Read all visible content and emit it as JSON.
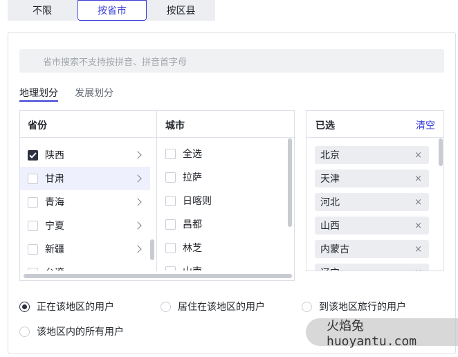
{
  "top_tabs": [
    {
      "label": "不限"
    },
    {
      "label": "按省市"
    },
    {
      "label": "按区县"
    }
  ],
  "search": {
    "placeholder": "省市搜索不支持按拼音、拼音首字母"
  },
  "division_tabs": [
    {
      "label": "地理划分"
    },
    {
      "label": "发展划分"
    }
  ],
  "province_panel": {
    "header": "省份",
    "items": [
      {
        "label": "陕西",
        "checked": true
      },
      {
        "label": "甘肃",
        "checked": false
      },
      {
        "label": "青海",
        "checked": false
      },
      {
        "label": "宁夏",
        "checked": false
      },
      {
        "label": "新疆",
        "checked": false
      },
      {
        "label": "台湾",
        "checked": false
      }
    ]
  },
  "city_panel": {
    "header": "城市",
    "items": [
      {
        "label": "全选"
      },
      {
        "label": "拉萨"
      },
      {
        "label": "日喀则"
      },
      {
        "label": "昌都"
      },
      {
        "label": "林芝"
      },
      {
        "label": "山南"
      }
    ]
  },
  "selected_panel": {
    "header": "已选",
    "clear_label": "清空",
    "items": [
      {
        "label": "北京"
      },
      {
        "label": "天津"
      },
      {
        "label": "河北"
      },
      {
        "label": "山西"
      },
      {
        "label": "内蒙古"
      },
      {
        "label": "辽宁"
      }
    ],
    "remove_glyph": "×"
  },
  "user_options": [
    {
      "label": "正在该地区的用户",
      "selected": true
    },
    {
      "label": "居住在该地区的用户",
      "selected": false
    },
    {
      "label": "到该地区旅行的用户",
      "selected": false
    },
    {
      "label": "该地区内的所有用户",
      "selected": false
    }
  ],
  "watermark": {
    "text": "火焰兔 huoyantu.com"
  },
  "colors": {
    "accent": "#3a3fd6",
    "checked": "#2b2f40",
    "highlight": "#eef0fd"
  }
}
